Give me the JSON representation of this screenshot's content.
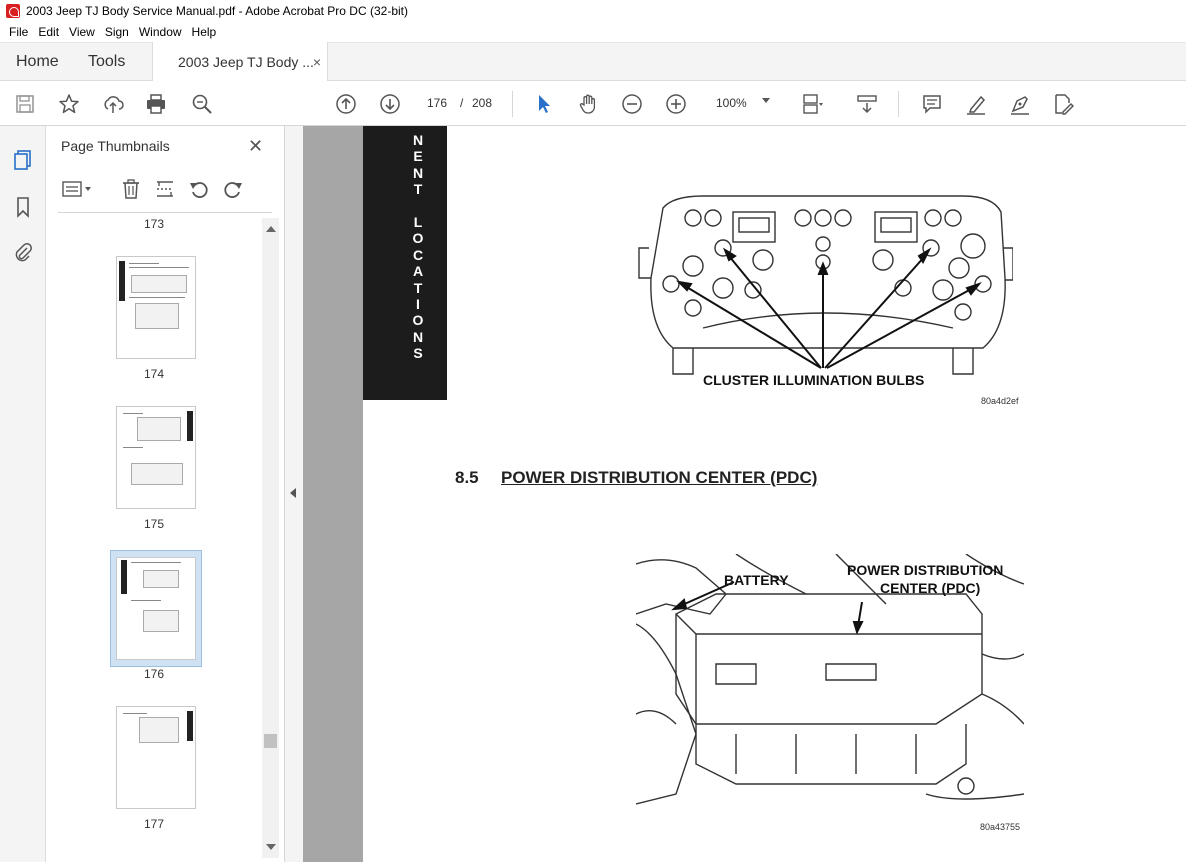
{
  "window": {
    "title": "2003 Jeep TJ Body Service Manual.pdf - Adobe Acrobat Pro DC (32-bit)"
  },
  "menu": [
    "File",
    "Edit",
    "View",
    "Sign",
    "Window",
    "Help"
  ],
  "tabs": {
    "home": "Home",
    "tools": "Tools",
    "document": "2003 Jeep TJ Body ...",
    "close_glyph": "×"
  },
  "toolbar": {
    "current_page": "176",
    "page_separator": "/",
    "total_pages": "208",
    "zoom": "100%",
    "icons": [
      "save-icon",
      "bookmark-star-icon",
      "upload-icon",
      "print-icon",
      "zoom-search-icon",
      "page-up-icon",
      "page-down-icon",
      "select-cursor-icon",
      "hand-icon",
      "zoom-out-icon",
      "zoom-in-icon",
      "page-layout-icon",
      "scroll-mode-icon",
      "comment-icon",
      "highlight-icon",
      "sign-icon",
      "edit-pdf-icon"
    ]
  },
  "thumb_panel": {
    "title": "Page Thumbnails",
    "close_glyph": "✕",
    "thumbnails": [
      {
        "label": "173"
      },
      {
        "label": "174"
      },
      {
        "label": "175"
      },
      {
        "label": "176",
        "selected": true
      },
      {
        "label": "177"
      }
    ]
  },
  "document": {
    "side_tab_text": "N\nE\nN\nT\n \nL\nO\nC\nA\nT\nI\nO\nN\nS",
    "figure1_label": "CLUSTER ILLUMINATION BULBS",
    "figure1_code": "80a4d2ef",
    "section_number": "8.5",
    "section_title": "POWER DISTRIBUTION CENTER (PDC)",
    "figure2_battery": "BATTERY",
    "figure2_pdc_line1": "POWER DISTRIBUTION",
    "figure2_pdc_line2": "CENTER (PDC)",
    "figure2_code": "80a43755"
  }
}
